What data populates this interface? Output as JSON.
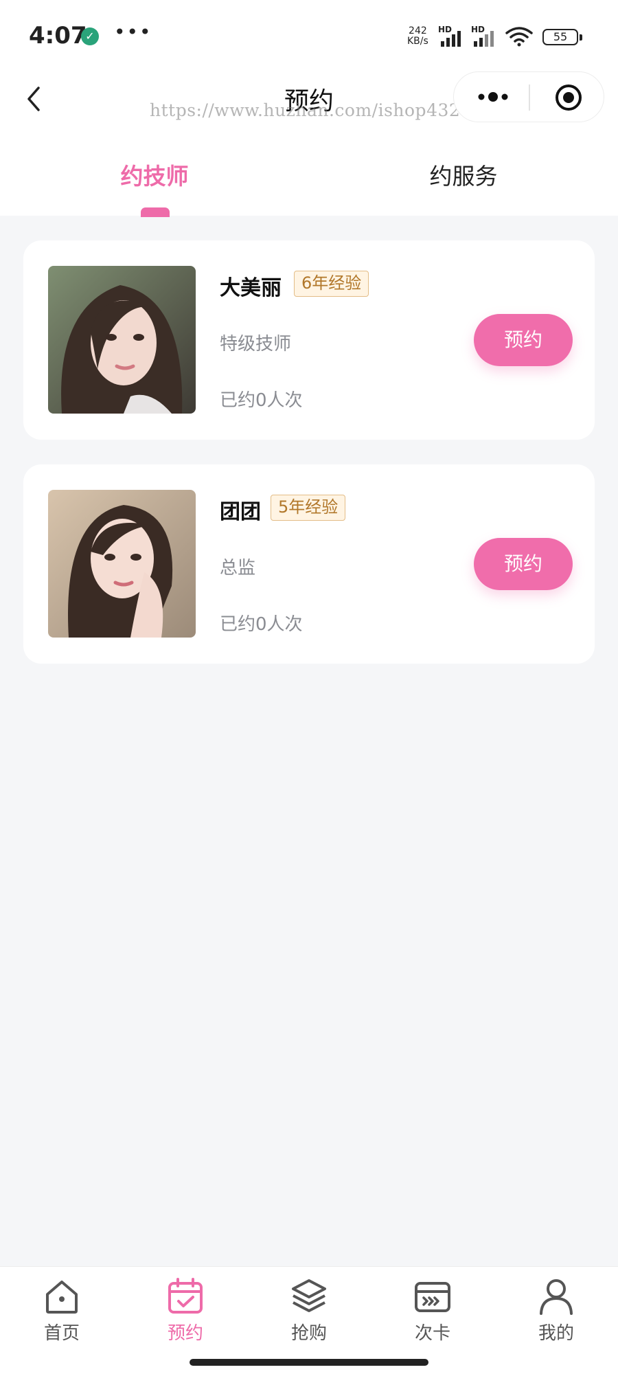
{
  "status_bar": {
    "time": "4:07",
    "speed_value": "242",
    "speed_unit": "KB/s",
    "hd1": "HD",
    "hd2": "HD",
    "battery": "55"
  },
  "nav": {
    "title": "预约",
    "watermark": "https://www.huzhan.com/ishop43289"
  },
  "tabs": {
    "technician": "约技师",
    "service": "约服务",
    "active": "technician"
  },
  "technicians": [
    {
      "name": "大美丽",
      "experience": "6年经验",
      "title": "特级技师",
      "booked": "已约0人次",
      "button": "预约"
    },
    {
      "name": "团团",
      "experience": "5年经验",
      "title": "总监",
      "booked": "已约0人次",
      "button": "预约"
    }
  ],
  "tabbar": {
    "items": [
      {
        "label": "首页",
        "icon": "home-icon"
      },
      {
        "label": "预约",
        "icon": "calendar-check-icon"
      },
      {
        "label": "抢购",
        "icon": "layers-icon"
      },
      {
        "label": "次卡",
        "icon": "card-icon"
      },
      {
        "label": "我的",
        "icon": "user-icon"
      }
    ],
    "active_index": 1
  },
  "colors": {
    "accent": "#ee6ba9",
    "badge_text": "#b1772a",
    "badge_bg": "#fff4e3",
    "muted_text": "#8a8c92",
    "page_bg": "#f5f6f8"
  }
}
